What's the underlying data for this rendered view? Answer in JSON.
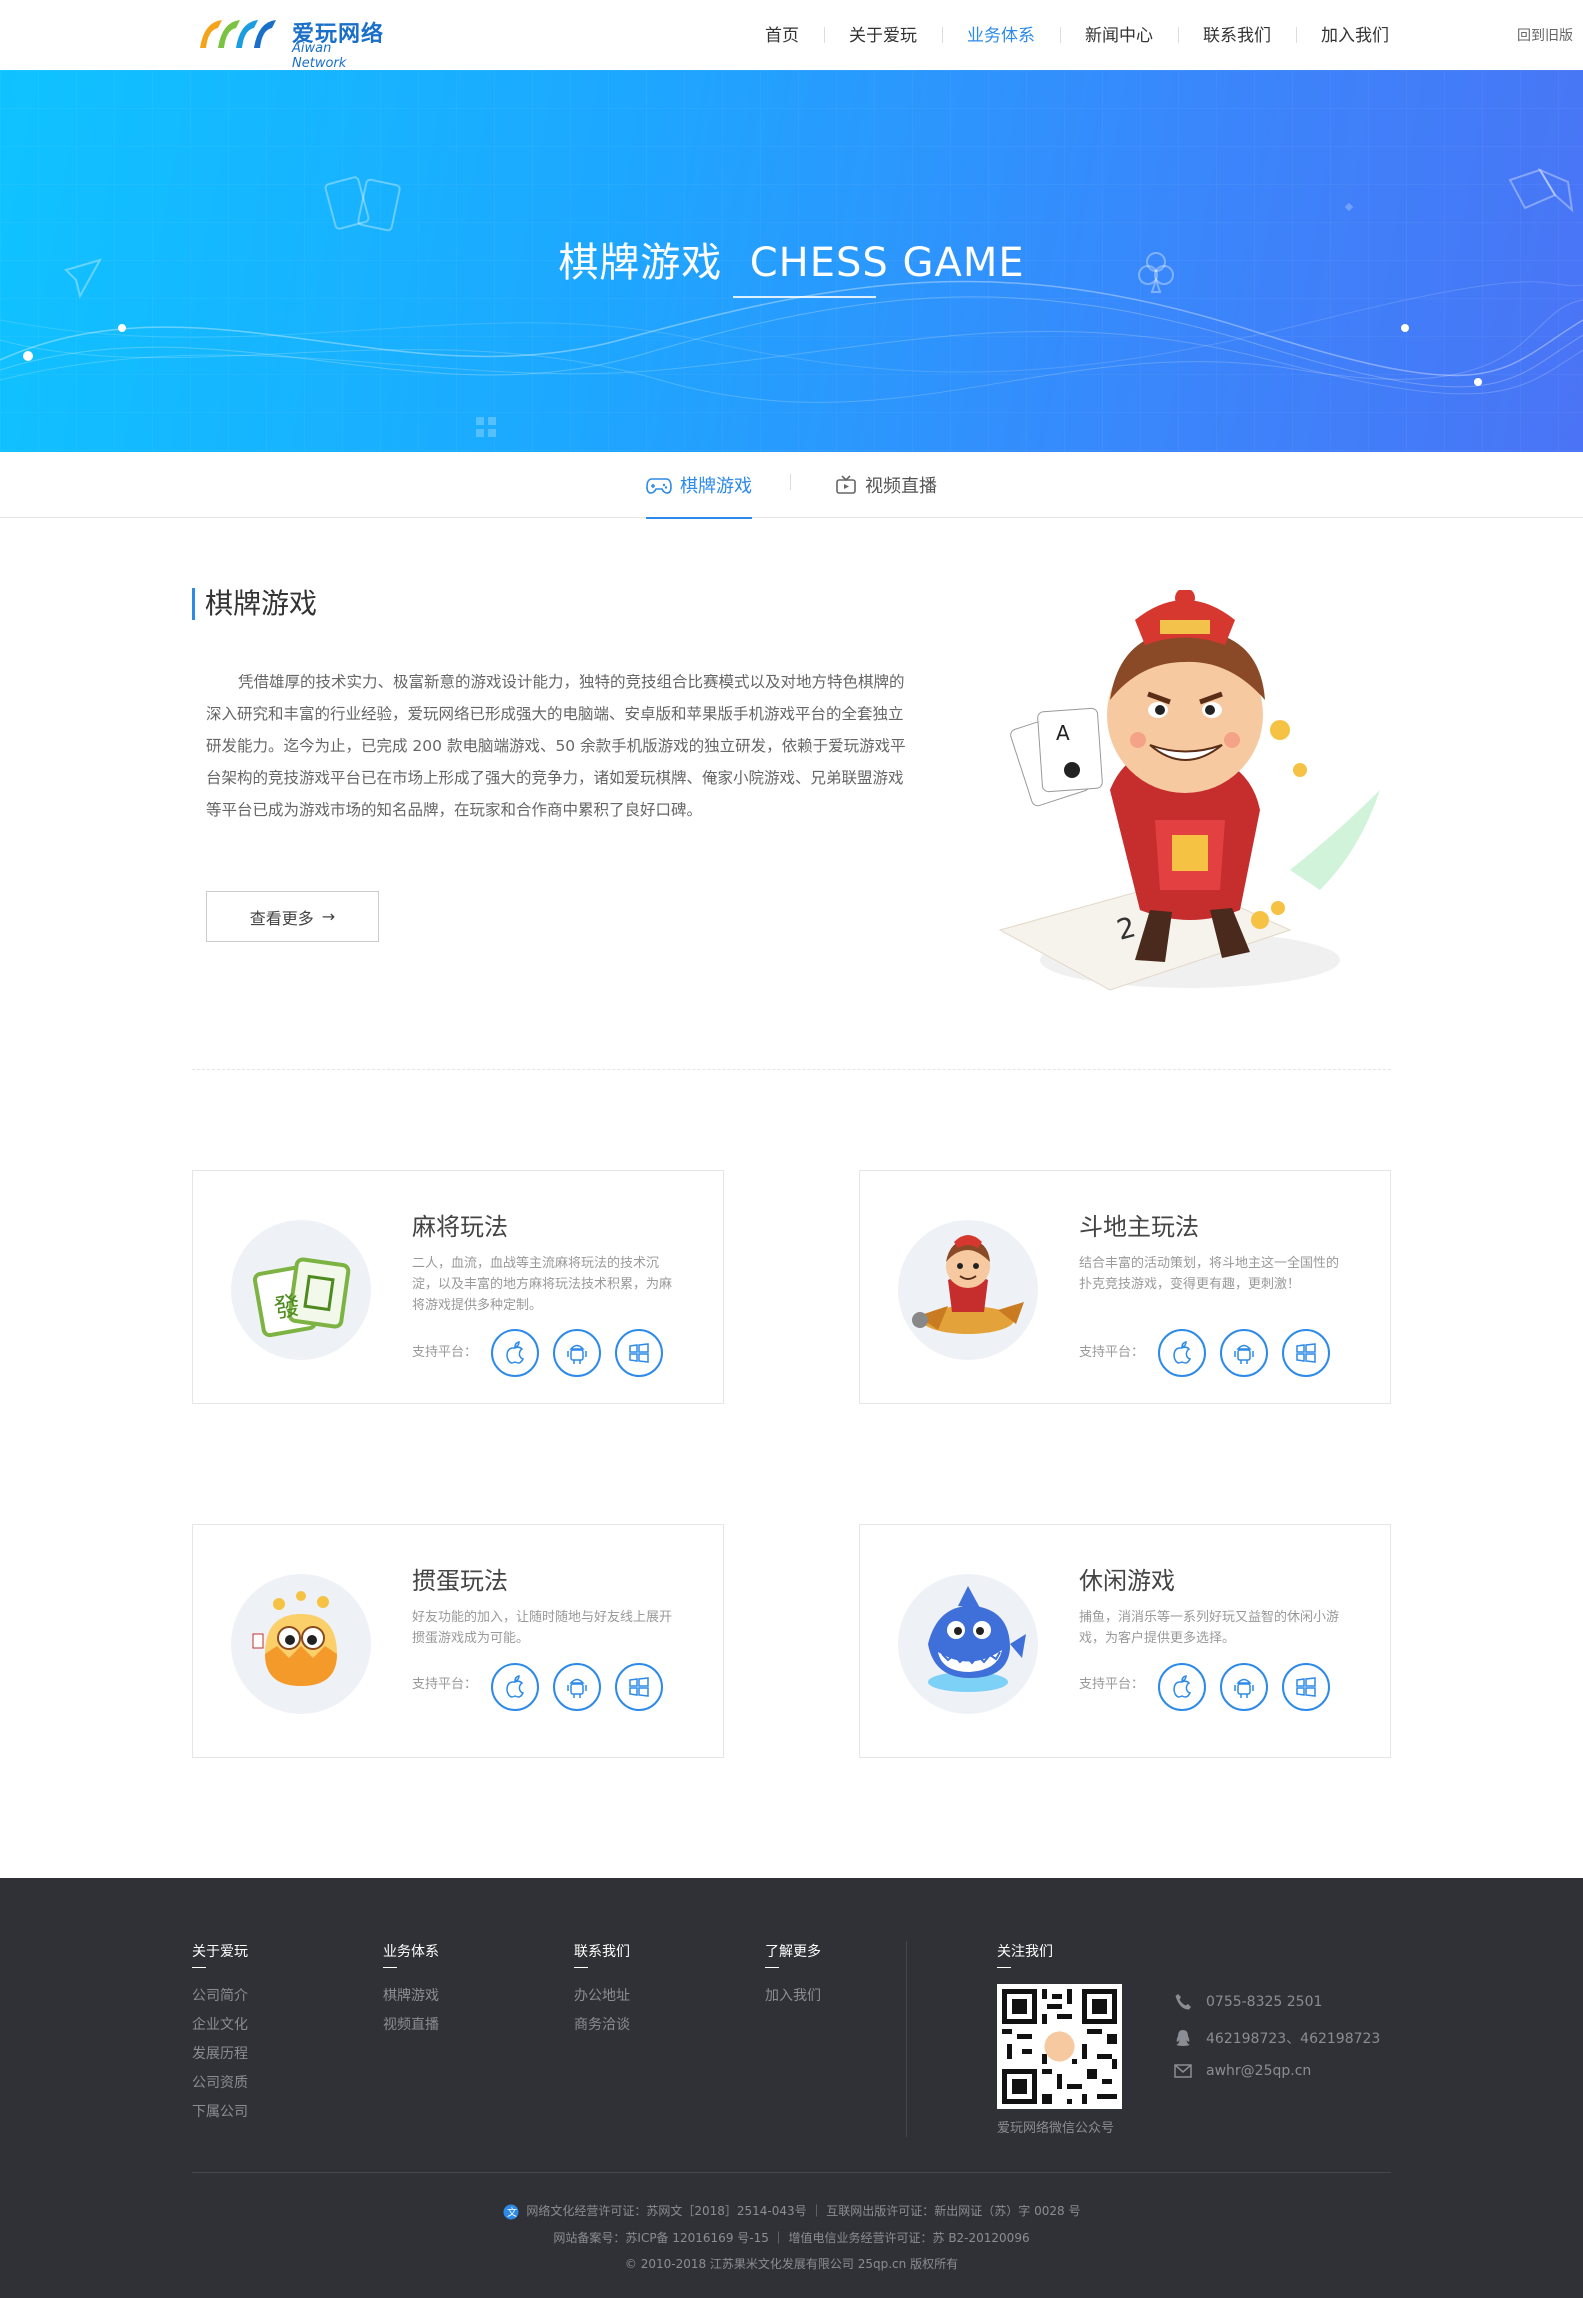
{
  "header": {
    "logo_text": "爱玩网络",
    "logo_sub": "Aiwan Network",
    "nav": [
      "首页",
      "关于爱玩",
      "业务体系",
      "新闻中心",
      "联系我们",
      "加入我们"
    ],
    "active_nav": "业务体系",
    "back_old": "回到旧版"
  },
  "banner": {
    "title": "棋牌游戏  CHESS GAME"
  },
  "tabs": [
    {
      "label": "棋牌游戏",
      "icon": "gamepad-icon",
      "active": true
    },
    {
      "label": "视频直播",
      "icon": "tv-icon",
      "active": false
    }
  ],
  "intro": {
    "title": "棋牌游戏",
    "text": "凭借雄厚的技术实力、极富新意的游戏设计能力，独特的竞技组合比赛模式以及对地方特色棋牌的深入研究和丰富的行业经验，爱玩网络已形成强大的电脑端、安卓版和苹果版手机游戏平台的全套独立研发能力。迄今为止，已完成 200 款电脑端游戏、50 余款手机版游戏的独立研发，依赖于爱玩游戏平台架构的竞技游戏平台已在市场上形成了强大的竞争力，诸如爱玩棋牌、俺家小院游戏、兄弟联盟游戏等平台已成为游戏市场的知名品牌，在玩家和合作商中累积了良好口碑。",
    "more_label": "查看更多",
    "more_arrow": "→"
  },
  "cards": [
    {
      "title": "麻将玩法",
      "desc": "二人，血流，血战等主流麻将玩法的技术沉淀，以及丰富的地方麻将玩法技术积累，为麻将游戏提供多种定制。",
      "platform_label": "支持平台：",
      "image": "mahjong-tile"
    },
    {
      "title": "斗地主玩法",
      "desc": "结合丰富的活动策划，将斗地主这一全国性的扑克竞技游戏，变得更有趣，更刺激！",
      "platform_label": "支持平台：",
      "image": "boy-on-plane"
    },
    {
      "title": "掼蛋玩法",
      "desc": "好友功能的加入，让随时随地与好友线上展开掼蛋游戏成为可能。",
      "platform_label": "支持平台：",
      "image": "egg-character"
    },
    {
      "title": "休闲游戏",
      "desc": "捕鱼，消消乐等一系列好玩又益智的休闲小游戏，为客户提供更多选择。",
      "platform_label": "支持平台：",
      "image": "shark-character"
    }
  ],
  "platform_icons": [
    "apple-icon",
    "android-icon",
    "windows-icon"
  ],
  "footer": {
    "columns": [
      {
        "title": "关于爱玩",
        "links": [
          "公司简介",
          "企业文化",
          "发展历程",
          "公司资质",
          "下属公司"
        ]
      },
      {
        "title": "业务体系",
        "links": [
          "棋牌游戏",
          "视频直播"
        ]
      },
      {
        "title": "联系我们",
        "links": [
          "办公地址",
          "商务洽谈"
        ]
      },
      {
        "title": "了解更多",
        "links": [
          "加入我们"
        ]
      }
    ],
    "follow_title": "关注我们",
    "qr_caption": "爱玩网络微信公众号",
    "contacts": [
      {
        "icon": "phone-icon",
        "text": "0755-8325 2501"
      },
      {
        "icon": "qq-icon",
        "text": "462198723、462198723"
      },
      {
        "icon": "mail-icon",
        "text": "awhr@25qp.cn"
      }
    ],
    "legal": [
      "网络文化经营许可证：苏网文［2018］2514-043号 ｜ 互联网出版许可证：新出网证（苏）字 0028 号",
      "网站备案号：苏ICP备 12016169 号-15 ｜ 增值电信业务经营许可证：苏 B2-20120096",
      "© 2010-2018 江苏果米文化发展有限公司 25qp.cn 版权所有"
    ]
  },
  "colors": {
    "accent": "#2d8ae8",
    "footer_bg": "#2f3136",
    "banner_start": "#0fc3ff",
    "banner_end": "#4a74f5"
  }
}
